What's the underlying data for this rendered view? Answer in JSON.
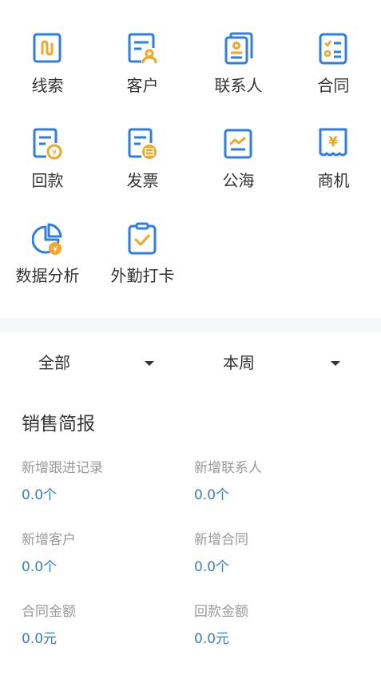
{
  "grid": {
    "items": [
      {
        "label": "线索",
        "icon": "lead-icon"
      },
      {
        "label": "客户",
        "icon": "customer-icon"
      },
      {
        "label": "联系人",
        "icon": "contacts-icon"
      },
      {
        "label": "合同",
        "icon": "contract-icon"
      },
      {
        "label": "回款",
        "icon": "payment-collection-icon"
      },
      {
        "label": "发票",
        "icon": "invoice-icon"
      },
      {
        "label": "公海",
        "icon": "public-pool-icon"
      },
      {
        "label": "商机",
        "icon": "opportunity-icon"
      },
      {
        "label": "数据分析",
        "icon": "data-analysis-icon"
      },
      {
        "label": "外勤打卡",
        "icon": "field-checkin-icon"
      }
    ]
  },
  "filters": {
    "scope": "全部",
    "period": "本周"
  },
  "report": {
    "title": "销售简报",
    "metrics": [
      {
        "label": "新增跟进记录",
        "value": "0.0个"
      },
      {
        "label": "新增联系人",
        "value": "0.0个"
      },
      {
        "label": "新增客户",
        "value": "0.0个"
      },
      {
        "label": "新增合同",
        "value": "0.0个"
      },
      {
        "label": "合同金额",
        "value": "0.0元"
      },
      {
        "label": "回款金额",
        "value": "0.0元"
      }
    ]
  },
  "colors": {
    "icon_blue": "#2f7ee7",
    "icon_orange": "#f5a623",
    "value_blue": "#2f7ee7",
    "band": "#f5f6f8"
  }
}
